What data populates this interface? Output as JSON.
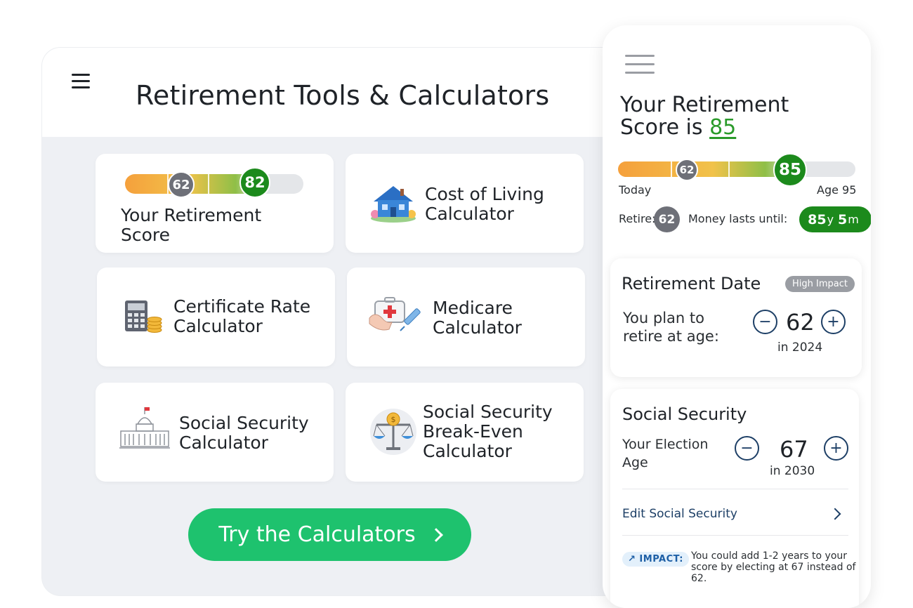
{
  "tablet": {
    "title": "Retirement Tools & Calculators",
    "cards": {
      "score": {
        "label_line1": "Your Retirement",
        "label_line2": "Score",
        "current_age": "62",
        "score": "82"
      },
      "cost_of_living": {
        "line1": "Cost of Living",
        "line2": "Calculator",
        "icon": "house-icon"
      },
      "certificate_rate": {
        "line1": "Certificate Rate",
        "line2": "Calculator",
        "icon": "calculator-coins-icon"
      },
      "medicare": {
        "line1": "Medicare",
        "line2": "Calculator",
        "icon": "medical-kit-icon"
      },
      "social_security": {
        "line1": "Social Security",
        "line2": "Calculator",
        "icon": "capitol-building-icon"
      },
      "break_even": {
        "line1": "Social Security",
        "line2": "Break-Even",
        "line3": "Calculator",
        "icon": "balance-scale-icon"
      }
    },
    "cta_label": "Try the Calculators"
  },
  "phone": {
    "title_line1": "Your Retirement",
    "title_line2_prefix": "Score is ",
    "score": "85",
    "bar": {
      "current_age": "62",
      "score": "85",
      "left_caption": "Today",
      "right_caption": "Age 95"
    },
    "retire_label": "Retire:",
    "retire_age": "62",
    "money_label": "Money lasts until:",
    "money_years": "85",
    "money_years_unit": "y",
    "money_months": "5",
    "money_months_unit": "m",
    "retirement_date": {
      "title": "Retirement Date",
      "badge": "High Impact",
      "label_line1": "You plan to",
      "label_line2": "retire at age:",
      "age": "62",
      "year": "in 2024",
      "minus": "−",
      "plus": "+"
    },
    "social_security": {
      "title": "Social Security",
      "label_line1": "Your Election",
      "label_line2": "Age",
      "age": "67",
      "year": "in 2030",
      "minus": "−",
      "plus": "+",
      "edit_link": "Edit Social Security",
      "impact_badge": "↗ IMPACT:",
      "impact_line1": "You could add 1-2 years to your",
      "impact_line2": "score by electing at 67 instead of",
      "impact_line3": "62."
    }
  },
  "colors": {
    "green_accent": "#1c8a1c",
    "cta_green": "#1ec26e",
    "navy": "#1d3f66",
    "gray_dot": "#6e7078"
  }
}
